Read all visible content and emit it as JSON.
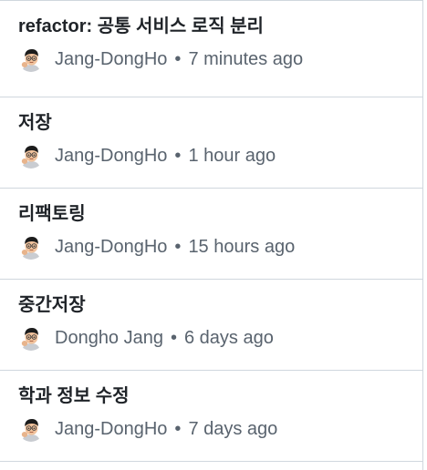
{
  "commits": [
    {
      "title": "refactor: 공통 서비스 로직 분리",
      "author": "Jang-DongHo",
      "separator": "•",
      "time": "7 minutes ago"
    },
    {
      "title": "저장",
      "author": "Jang-DongHo",
      "separator": "•",
      "time": "1 hour ago"
    },
    {
      "title": "리팩토링",
      "author": "Jang-DongHo",
      "separator": "•",
      "time": "15 hours ago"
    },
    {
      "title": "중간저장",
      "author": "Dongho Jang",
      "separator": "•",
      "time": "6 days ago"
    },
    {
      "title": "학과 정보 수정",
      "author": "Jang-DongHo",
      "separator": "•",
      "time": "7 days ago"
    }
  ],
  "icons": {
    "avatar": "memoji-avatar-icon"
  },
  "colors": {
    "border": "#d0d7de",
    "title": "#1f2328",
    "meta": "#59636e"
  }
}
